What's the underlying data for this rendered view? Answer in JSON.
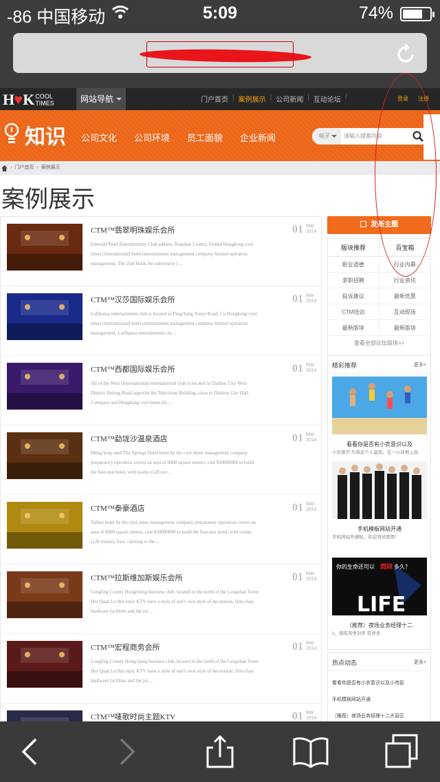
{
  "status_bar": {
    "signal": "-86",
    "carrier": "中国移动",
    "time": "5:09",
    "battery_pct": "74%",
    "battery_level": 0.74
  },
  "browser": {
    "url": "",
    "reload_icon": "reload-icon"
  },
  "site": {
    "logo_text": "HK",
    "logo_sub1": "COOL",
    "logo_sub2": "TIMES",
    "nav_button": "网站导航",
    "top_links": [
      "门户首页",
      "案例展示",
      "公司新闻",
      "互动论坛"
    ],
    "active_link": "案例展示",
    "login": "登录",
    "register": "注册",
    "section_title": "知识",
    "category_nav": [
      "公司文化",
      "公司环境",
      "员工面貌",
      "企业新闻"
    ],
    "search": {
      "scope": "帖子",
      "placeholder": "请输入搜索内容"
    },
    "breadcrumb": [
      "门户首页",
      "案例展示"
    ],
    "page_title": "案例展示"
  },
  "cases": [
    {
      "title": "CTM™翡翠明珠娱乐会所",
      "desc": "Emerald Pearl Entertainment Club address Xuanhan County, United Hongkong cool times (International) hotel entertainment management company limited operation management. The club holds the subversive i ...",
      "day": "01",
      "month": "Mar",
      "year": "2014",
      "thumb_color": "#6a2a10"
    },
    {
      "title": "CTM™汉莎国际娱乐会所",
      "desc": "Lufthansa entertainment club is located in Pingchang Xunyi Road, Co Hongkong cool times (International) hotel entertainment management company limited operation management. Lufthansa entertainment clu ...",
      "day": "01",
      "month": "Mar",
      "year": "2014",
      "thumb_color": "#1a2a8a"
    },
    {
      "title": "CTM™西都国际娱乐会所",
      "desc": "All of the West (International) entertainment club is located in Dazhou City West District Jinlong Road opposite the Television Building, close to Dazhou City Hall. Company and Hongkong cool times (In ...",
      "day": "01",
      "month": "Mar",
      "year": "2014",
      "thumb_color": "#3a1a6a"
    },
    {
      "title": "CTM™勐垅沙温泉酒店",
      "desc": "Meng long sand The Springs Hotel hotel by the cool times management company preparatory operation covers an area of 6000 square meters, cost $30000000 to build the four-star hotel, with rooms (128 roo ...",
      "day": "01",
      "month": "Mar",
      "year": "2014",
      "thumb_color": "#5a3010"
    },
    {
      "title": "CTM™泰豪酒店",
      "desc": "Taihao hotel by the cool times management company preparatory operation covers an area of 6000 square meters, cost $30000000 to build the four-star hotel, with rooms (128 rooms), bars, catering to the ...",
      "day": "01",
      "month": "Mar",
      "year": "2014",
      "thumb_color": "#b08a10"
    },
    {
      "title": "CTM™拉斯维加斯娱乐会所",
      "desc": "Longling County Hongcheng business club, located in the north of the Longshan Town Hot Quan Lu this topic KTV have a style of one's own style of decoration, first-class hardware facilities and the joi ...",
      "day": "01",
      "month": "Mar",
      "year": "2014",
      "thumb_color": "#7a3a1a"
    },
    {
      "title": "CTM™宏程商务会所",
      "desc": "Longling County Hongcheng business club, located in the north of the Longshan Town Hot Quan Lu this topic KTV have a style of one's own style of decoration, first-class hardware facilities and the joi ...",
      "day": "01",
      "month": "Mar",
      "year": "2014",
      "thumb_color": "#5a1a1a"
    },
    {
      "title": "CTM™唛歌时尚主题KTV",
      "desc": "",
      "day": "01",
      "month": "Mar",
      "year": "2014",
      "thumb_color": "#2a2a4a"
    }
  ],
  "sidebar": {
    "post_button": "发新主题",
    "forum_tabs": [
      "版块推荐",
      "百宝箱"
    ],
    "forums": [
      "职业道德",
      "行业内幕",
      "求职招聘",
      "行业资讯",
      "投诉建议",
      "最新优惠",
      "CTM培训",
      "互动现场",
      "最新版块",
      "最新版块"
    ],
    "forums_more": "查看全部论坛版块>>",
    "recommend_title": "精彩推荐",
    "recommend_more": "更多>",
    "recommend": [
      {
        "caption": "看看你是否有小农意识以及",
        "sub": "小农意识 为满足个人温饱，在一小块地上自"
      },
      {
        "caption": "手机模板网站开通",
        "sub": "手机网站开通啦，欢迎测试使用！"
      },
      {
        "caption": "（推荐）夜场业务经理十二",
        "sub": "1、择库竞争对手 有很多",
        "image_text1": "你的生命还可以",
        "image_text2": "燃烧",
        "image_text3": "多久?",
        "image_text4": "LIFE"
      }
    ],
    "hot_title": "热点动态",
    "hot_more": "更多>",
    "hot": [
      "看看你是否有小农意识以及小市民",
      "手机模板网站开通",
      "（推荐）夜场业务经理十二大盲区"
    ]
  },
  "toolbar": {
    "icons": [
      "back-icon",
      "forward-icon",
      "share-icon",
      "bookmarks-icon",
      "tabs-icon"
    ]
  }
}
